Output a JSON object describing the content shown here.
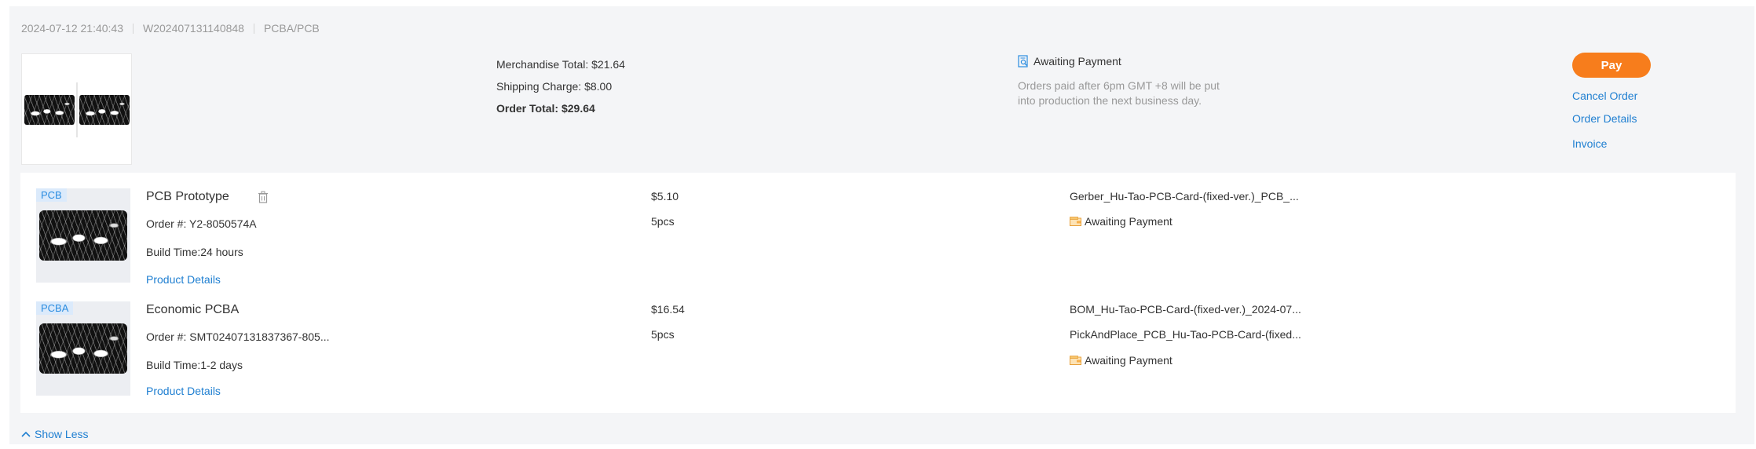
{
  "order": {
    "datetime": "2024-07-12 21:40:43",
    "order_number": "W202407131140848",
    "category": "PCBA/PCB"
  },
  "totals": {
    "merchandise": "Merchandise Total: $21.64",
    "shipping": "Shipping Charge: $8.00",
    "order_total": "Order Total: $29.64"
  },
  "status": {
    "icon": "search-document-icon",
    "label": "Awaiting Payment",
    "note_line1": "Orders paid after 6pm GMT +8 will be put",
    "note_line2": "into production the next business day."
  },
  "actions": {
    "pay": "Pay",
    "cancel": "Cancel Order",
    "details": "Order Details",
    "invoice": "Invoice"
  },
  "items": [
    {
      "tag": "PCB",
      "name": "PCB Prototype",
      "order_no": "Order #: Y2-8050574A",
      "build_time": "Build Time:24 hours",
      "details_link": "Product Details",
      "price": "$5.10",
      "qty": "5pcs",
      "files": [
        "Gerber_Hu-Tao-PCB-Card-(fixed-ver.)_PCB_..."
      ],
      "status": "Awaiting Payment"
    },
    {
      "tag": "PCBA",
      "name": "Economic PCBA",
      "order_no": "Order #: SMT02407131837367-805...",
      "build_time": "Build Time:1-2 days",
      "details_link": "Product Details",
      "price": "$16.54",
      "qty": "5pcs",
      "files": [
        "BOM_Hu-Tao-PCB-Card-(fixed-ver.)_2024-07...",
        "PickAndPlace_PCB_Hu-Tao-PCB-Card-(fixed..."
      ],
      "status": "Awaiting Payment"
    }
  ],
  "footer": {
    "show_less": "Show Less"
  },
  "colors": {
    "accent_orange": "#f77d1c",
    "link_blue": "#1f7fd1",
    "tag_blue": "#2a8ce0",
    "muted_text": "#999999",
    "card_bg": "#f4f5f7"
  }
}
